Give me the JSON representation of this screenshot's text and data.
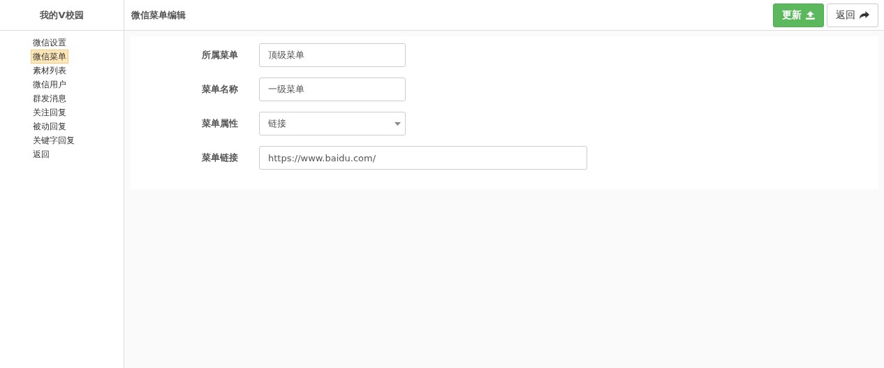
{
  "sidebar": {
    "title": "我的V校园",
    "items": [
      {
        "label": "微信设置",
        "selected": false
      },
      {
        "label": "微信菜单",
        "selected": true
      },
      {
        "label": "素材列表",
        "selected": false
      },
      {
        "label": "微信用户",
        "selected": false
      },
      {
        "label": "群发消息",
        "selected": false
      },
      {
        "label": "关注回复",
        "selected": false
      },
      {
        "label": "被动回复",
        "selected": false
      },
      {
        "label": "关键字回复",
        "selected": false
      },
      {
        "label": "返回",
        "selected": false
      }
    ]
  },
  "header": {
    "title": "微信菜单编辑",
    "buttons": [
      {
        "label": "更新",
        "kind": "primary"
      },
      {
        "label": "返回",
        "kind": "default"
      }
    ]
  },
  "form": {
    "fields": [
      {
        "label": "所属菜单",
        "kind": "input",
        "value": "顶级菜单",
        "wide": false
      },
      {
        "label": "菜单名称",
        "kind": "input",
        "value": "一级菜单",
        "wide": false
      },
      {
        "label": "菜单属性",
        "kind": "select",
        "value": "链接",
        "wide": false
      },
      {
        "label": "菜单链接",
        "kind": "input",
        "value": "https://www.baidu.com/",
        "wide": true
      }
    ]
  }
}
